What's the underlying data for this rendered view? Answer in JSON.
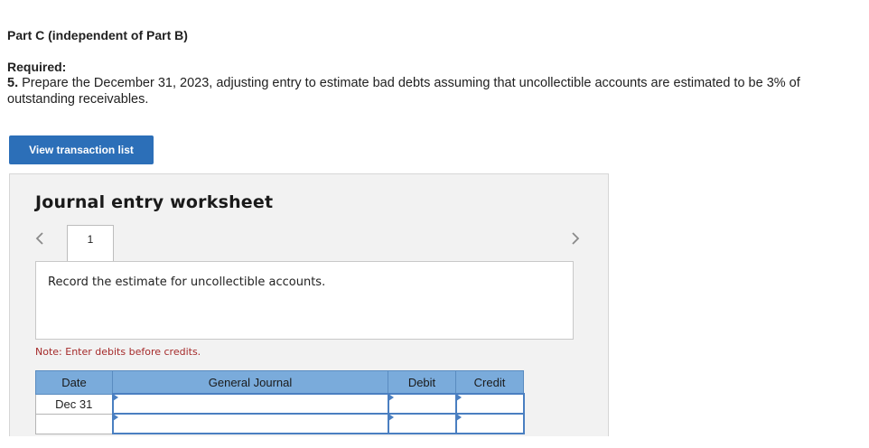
{
  "header": {
    "part_title": "Part C (independent of Part B)",
    "required_label": "Required:",
    "question_number": "5.",
    "question_text": "Prepare the December 31, 2023, adjusting entry to estimate bad debts assuming that uncollectible accounts are estimated to be 3% of outstanding receivables."
  },
  "buttons": {
    "view_transaction_list": "View transaction list"
  },
  "worksheet": {
    "title": "Journal entry worksheet",
    "tabs": [
      "1"
    ],
    "description": "Record the estimate for uncollectible accounts.",
    "note": "Note: Enter debits before credits.",
    "table": {
      "headers": [
        "Date",
        "General Journal",
        "Debit",
        "Credit"
      ],
      "rows": [
        {
          "date": "Dec 31",
          "general_journal": "",
          "debit": "",
          "credit": ""
        },
        {
          "date": "",
          "general_journal": "",
          "debit": "",
          "credit": ""
        }
      ]
    }
  },
  "icons": {
    "prev": "chevron-left-icon",
    "next": "chevron-right-icon"
  },
  "colors": {
    "button_bg": "#2c6fb8",
    "table_header_bg": "#7aabdb",
    "note_text": "#a52a2a",
    "input_border": "#4a7fc1"
  }
}
